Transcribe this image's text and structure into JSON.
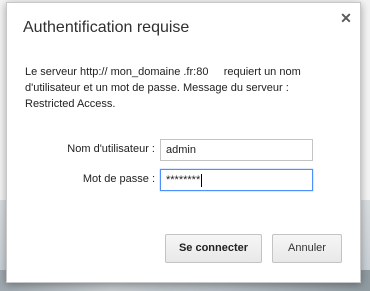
{
  "dialog": {
    "title": "Authentification requise",
    "close_icon": "close-icon",
    "message_line1": "Le serveur http:// mon_domaine .fr:80     requiert un nom",
    "message_line2": "d'utilisateur et un mot de passe. Message du serveur :",
    "message_line3": "Restricted Access."
  },
  "form": {
    "username_label": "Nom d'utilisateur :",
    "username_value": "admin",
    "password_label": "Mot de passe :",
    "password_value": "********"
  },
  "buttons": {
    "login_label": "Se connecter",
    "cancel_label": "Annuler"
  }
}
